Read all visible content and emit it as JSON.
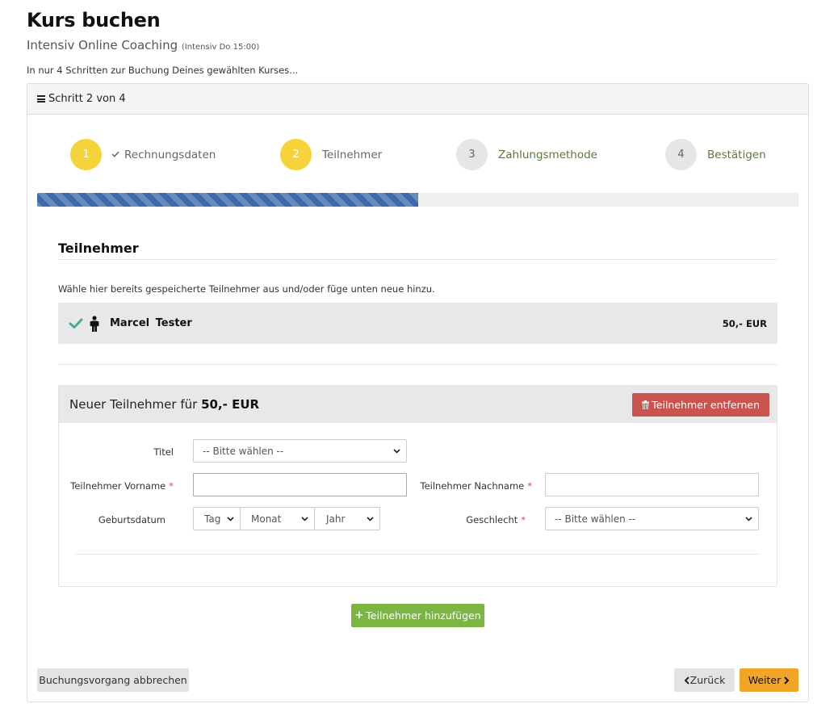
{
  "header": {
    "title": "Kurs buchen",
    "course_name": "Intensiv Online Coaching",
    "course_detail": "(Intensiv Do 15:00)",
    "intro": "In nur 4 Schritten zur Buchung Deines gewählten Kurses..."
  },
  "panel": {
    "step_indicator": "Schritt 2 von 4"
  },
  "steps": [
    {
      "number": "1",
      "label": "Rechnungsdaten",
      "status": "done"
    },
    {
      "number": "2",
      "label": "Teilnehmer",
      "status": "active"
    },
    {
      "number": "3",
      "label": "Zahlungsmethode",
      "status": "pending"
    },
    {
      "number": "4",
      "label": "Bestätigen",
      "status": "pending"
    }
  ],
  "progress": {
    "percent": 50,
    "color": "#3d6aa8"
  },
  "participants": {
    "section_title": "Teilnehmer",
    "hint": "Wähle hier bereits gespeicherte Teilnehmer aus und/oder füge unten neue hinzu.",
    "saved": [
      {
        "name": "Marcel  Tester",
        "price": "50,- EUR",
        "selected": true
      }
    ]
  },
  "new_participant": {
    "title_prefix": "Neuer Teilnehmer für",
    "price": "50,- EUR",
    "remove_label": "Teilnehmer entfernen",
    "fields": {
      "title_label": "Titel",
      "title_value": "-- Bitte wählen --",
      "firstname_label": "Teilnehmer Vorname",
      "firstname_value": "",
      "lastname_label": "Teilnehmer Nachname",
      "lastname_value": "",
      "birthdate_label": "Geburtsdatum",
      "day_value": "Tag",
      "month_value": "Monat",
      "year_value": "Jahr",
      "gender_label": "Geschlecht",
      "gender_value": "-- Bitte wählen --",
      "required_mark": "*"
    }
  },
  "actions": {
    "add_participant": "Teilnehmer hinzufügen",
    "add_icon": "+",
    "cancel": "Buchungsvorgang abbrechen",
    "back": "Zurück",
    "next": "Weiter"
  },
  "colors": {
    "step_active": "#f7d33b",
    "step_inactive": "#e6e6e6",
    "remove_button": "#c9534f",
    "add_button": "#7bb542",
    "next_button": "#f1a62a",
    "check": "#4fa79a"
  },
  "icons": {
    "menu": "menu-icon",
    "done_check": "check-icon",
    "selected_check": "check-icon",
    "person": "person-icon",
    "trash": "trash-icon",
    "chevron_down": "chevron-down-icon",
    "chevron_left": "chevron-left-icon",
    "chevron_right": "chevron-right-icon"
  }
}
